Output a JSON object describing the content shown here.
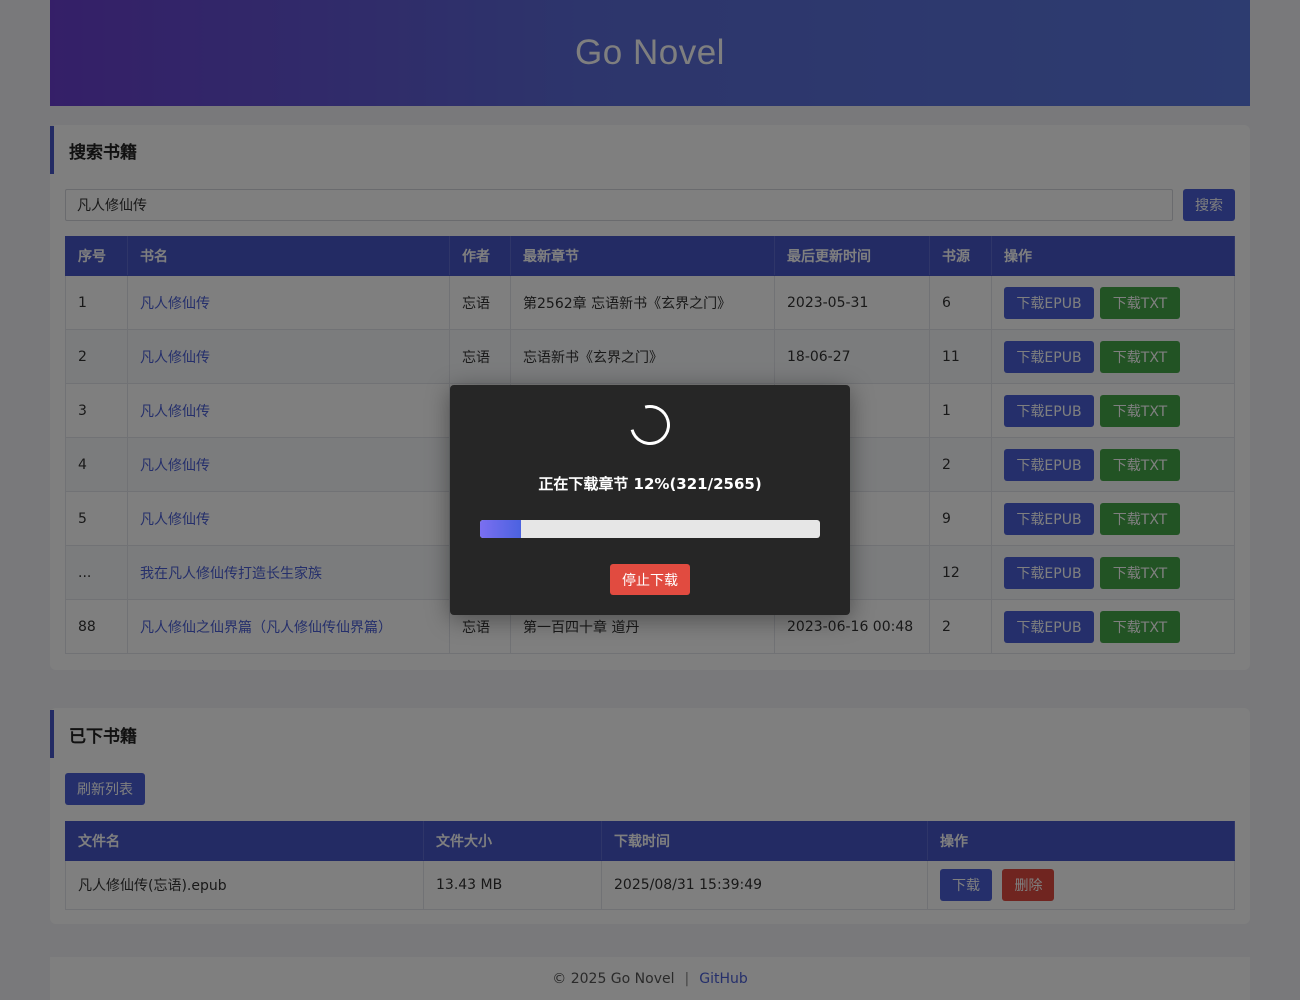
{
  "app": {
    "title": "Go Novel"
  },
  "search": {
    "section_title": "搜索书籍",
    "query": "凡人修仙传",
    "button_label": "搜索",
    "columns": [
      "序号",
      "书名",
      "作者",
      "最新章节",
      "最后更新时间",
      "书源",
      "操作"
    ],
    "rows": [
      {
        "no": "1",
        "title": "凡人修仙传",
        "author": "忘语",
        "latest": "第2562章 忘语新书《玄界之门》",
        "updated": "2023-05-31",
        "sources": "6"
      },
      {
        "no": "2",
        "title": "凡人修仙传",
        "author": "忘语",
        "latest": "忘语新书《玄界之门》",
        "updated": "18-06-27",
        "sources": "11"
      },
      {
        "no": "3",
        "title": "凡人修仙传",
        "author": "",
        "latest": "",
        "updated": "",
        "sources": "1"
      },
      {
        "no": "4",
        "title": "凡人修仙传",
        "author": "",
        "latest": "",
        "updated": "6 00:48",
        "sources": "2"
      },
      {
        "no": "5",
        "title": "凡人修仙传",
        "author": "",
        "latest": "",
        "updated": "",
        "sources": "9"
      },
      {
        "no": "...",
        "title": "我在凡人修仙传打造长生家族",
        "author": "",
        "latest": "",
        "updated": "",
        "sources": "12"
      },
      {
        "no": "88",
        "title": "凡人修仙之仙界篇（凡人修仙传仙界篇）",
        "author": "忘语",
        "latest": "第一百四十章 道丹",
        "updated": "2023-06-16 00:48",
        "sources": "2"
      }
    ],
    "epub_label": "下载EPUB",
    "txt_label": "下载TXT"
  },
  "downloads": {
    "section_title": "已下书籍",
    "refresh_label": "刷新列表",
    "columns": [
      "文件名",
      "文件大小",
      "下载时间",
      "操作"
    ],
    "rows": [
      {
        "filename": "凡人修仙传(忘语).epub",
        "size": "13.43 MB",
        "time": "2025/08/31 15:39:49"
      }
    ],
    "download_label": "下载",
    "delete_label": "删除"
  },
  "footer": {
    "copyright": "© 2025 Go Novel",
    "separator": "|",
    "link_label": "GitHub"
  },
  "modal": {
    "progress_text": "正在下载章节 12%(321/2565)",
    "progress_percent": 12,
    "stop_label": "停止下载"
  },
  "colors": {
    "primary": "#4656c8",
    "success": "#44a648",
    "danger": "#e14b40"
  },
  "icons": {
    "loading": "spinner-icon"
  }
}
